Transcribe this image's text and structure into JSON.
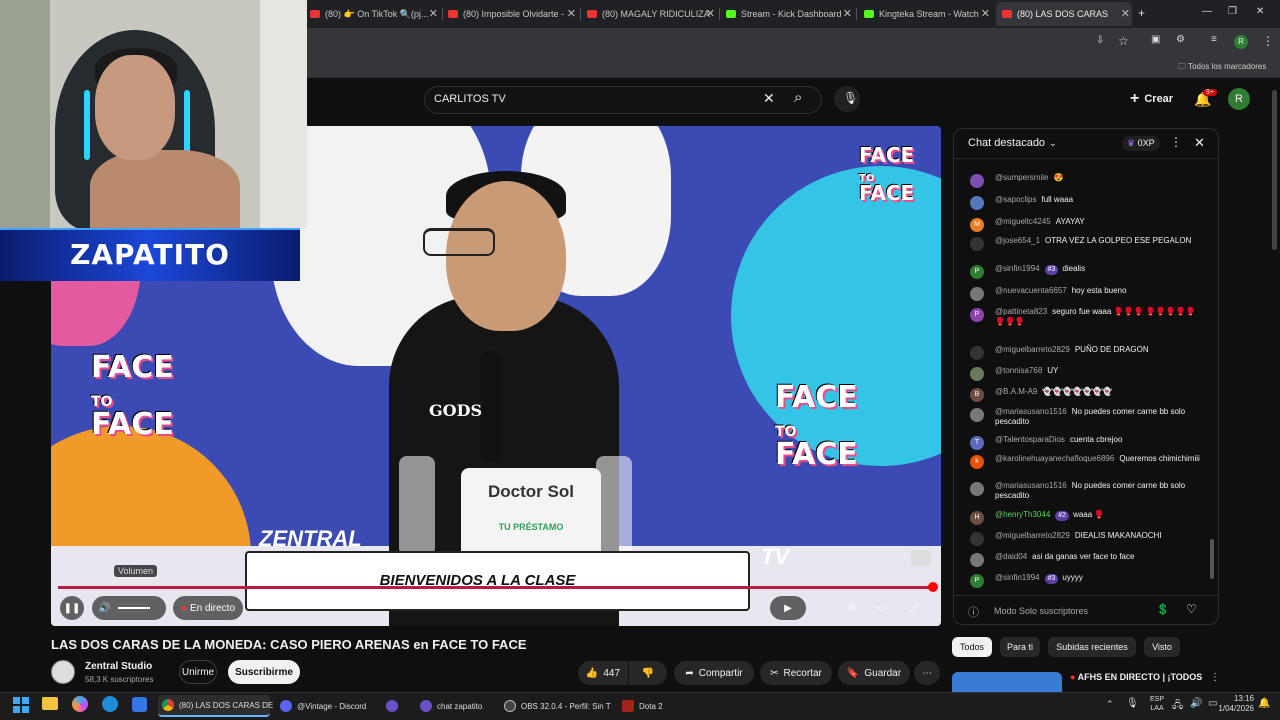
{
  "browser": {
    "tabs": [
      {
        "title": "(80) 👉 On TikTok 🔍(pj...",
        "fav": "#e33"
      },
      {
        "title": "(80) Imposible Olvidarte -",
        "fav": "#e33"
      },
      {
        "title": "(80) MAGALY RIDICULIZA",
        "fav": "#e33"
      },
      {
        "title": "Stream - Kick Dashboard",
        "fav": "#53fc18"
      },
      {
        "title": "Kingteka Stream - Watch",
        "fav": "#53fc18"
      },
      {
        "title": "(80) LAS DOS CARAS",
        "fav": "#e33"
      }
    ],
    "bookmarks_label": "Todos los marcadores",
    "profile_initial": "R"
  },
  "youtube": {
    "search_value": "CARLITOS TV",
    "create_label": "Crear",
    "notif_count": "9+",
    "avatar_initial": "R"
  },
  "webcam": {
    "overlay_name": "ZAPATITO"
  },
  "video": {
    "banner_text": "BIENVENIDOS A LA CLASE",
    "podium_brand": "Doctor Sol",
    "podium_sub": "TU PRÉSTAMO",
    "shirt_text": "GODS Y",
    "logo_line1": "FACE",
    "logo_to": "TO",
    "logo_line2": "FACE",
    "set_text": "ZENTRAL",
    "set_text_right": "TV",
    "volume_tooltip": "Volumen",
    "live_label": "En directo",
    "progress_percent": 100
  },
  "meta": {
    "title": "LAS DOS CARAS DE LA MONEDA: CASO PIERO ARENAS en FACE TO FACE",
    "channel": "Zentral Studio",
    "subscribers": "58,3 K suscriptores",
    "join_label": "Unirme",
    "subscribe_label": "Suscribirme",
    "likes": "447",
    "share_label": "Compartir",
    "clip_label": "Recortar",
    "save_label": "Guardar"
  },
  "chat": {
    "header": "Chat destacado",
    "points": "0XP",
    "footer": "Modo Solo suscriptores",
    "messages": [
      {
        "user": "@sumpersmile",
        "text": "😍",
        "color": "#7a4fb0",
        "init": ""
      },
      {
        "user": "@sapoclips",
        "text": "full waaa",
        "color": "#5577bb",
        "init": ""
      },
      {
        "user": "@migueltc4245",
        "text": "AYAYAY",
        "color": "#e67e22",
        "init": "M"
      },
      {
        "user": "@jose654_1",
        "text": "OTRA VEZ LA GOLPEO ESE PEGALON",
        "color": "#333",
        "init": ""
      },
      {
        "user": "@sinfin1994",
        "badge": "#3",
        "text": "diealis",
        "color": "#2e7d32",
        "init": "P"
      },
      {
        "user": "@nuevacuenta6657",
        "text": "hoy esta bueno",
        "color": "#777",
        "init": ""
      },
      {
        "user": "@pattineta823",
        "text": "seguro fue waaa 🥊🥊🥊 🥊🥊🥊🥊🥊🥊🥊🥊",
        "color": "#8e44ad",
        "init": "P"
      },
      {
        "user": "@miguelbarreto2829",
        "text": "PUÑO DE DRAGON",
        "color": "#333",
        "init": ""
      },
      {
        "user": "@tonnisa768",
        "text": "UY",
        "color": "#6a7a5a",
        "init": ""
      },
      {
        "user": "@B.A.M-A9",
        "text": "👻👻👻👻👻👻👻",
        "color": "#6d4c41",
        "init": "B"
      },
      {
        "user": "@mariasusano1516",
        "text": "No puedes comer carne bb solo pescadito",
        "color": "#777",
        "init": ""
      },
      {
        "user": "@TalentosparaDios",
        "text": "cuenta cbrejoo",
        "color": "#5c6bc0",
        "init": "T"
      },
      {
        "user": "@karolinehuayanechafloque6896",
        "text": "Queremos chimichimiii",
        "color": "#e65100",
        "init": "k"
      },
      {
        "user": "@mariasusano1516",
        "text": "No puedes comer carne bb solo pescadito",
        "color": "#777",
        "init": ""
      },
      {
        "user": "@henryTh3044",
        "badge": "#2",
        "text": "waaa 🥊",
        "color": "#6d4c41",
        "init": "H",
        "mod": true
      },
      {
        "user": "@miguelbarreto2829",
        "text": "DIEALIS MAKANAOCHI",
        "color": "#333",
        "init": ""
      },
      {
        "user": "@daid04",
        "text": "asi da ganas ver face to face",
        "color": "#777",
        "init": ""
      },
      {
        "user": "@sinfin1994",
        "badge": "#3",
        "text": "uyyyy",
        "color": "#2e7d32",
        "init": "P"
      }
    ]
  },
  "chips": [
    "Todos",
    "Para ti",
    "Subidas recientes",
    "Visto"
  ],
  "rec": {
    "title": "AFHS EN DIRECTO | ¡TODOS"
  },
  "taskbar": {
    "items": [
      {
        "label": "(80) LAS DOS CARAS DE",
        "color": "#4285f4",
        "active": true
      },
      {
        "label": "@Vintage - Discord",
        "color": "#5865f2"
      },
      {
        "label": "",
        "color": "#6a4fc8"
      },
      {
        "label": "chat zapatito",
        "color": "#6a4fc8"
      },
      {
        "label": "OBS 32.0.4 - Perfil: Sin T",
        "color": "#444"
      },
      {
        "label": "Dota 2",
        "color": "#a3221a"
      }
    ],
    "lang": "ESP",
    "lang2": "LAA",
    "time": "13:16",
    "date": "1/04/2026"
  }
}
